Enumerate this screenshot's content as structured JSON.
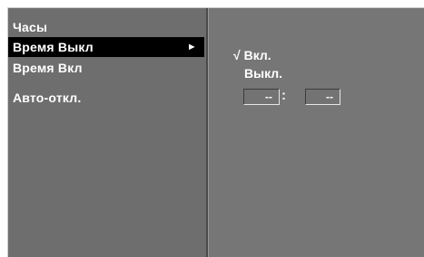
{
  "menu": {
    "title": "Часы",
    "items": [
      {
        "label": "Время Выкл",
        "arrow": "►"
      },
      {
        "label": "Время Вкл"
      },
      {
        "label": "Авто-откл."
      }
    ]
  },
  "submenu": {
    "options": [
      {
        "mark": "√",
        "label": "Вкл."
      },
      {
        "label": "Выкл."
      }
    ],
    "time": {
      "hours": "--",
      "separator": ":",
      "minutes": "--"
    }
  }
}
